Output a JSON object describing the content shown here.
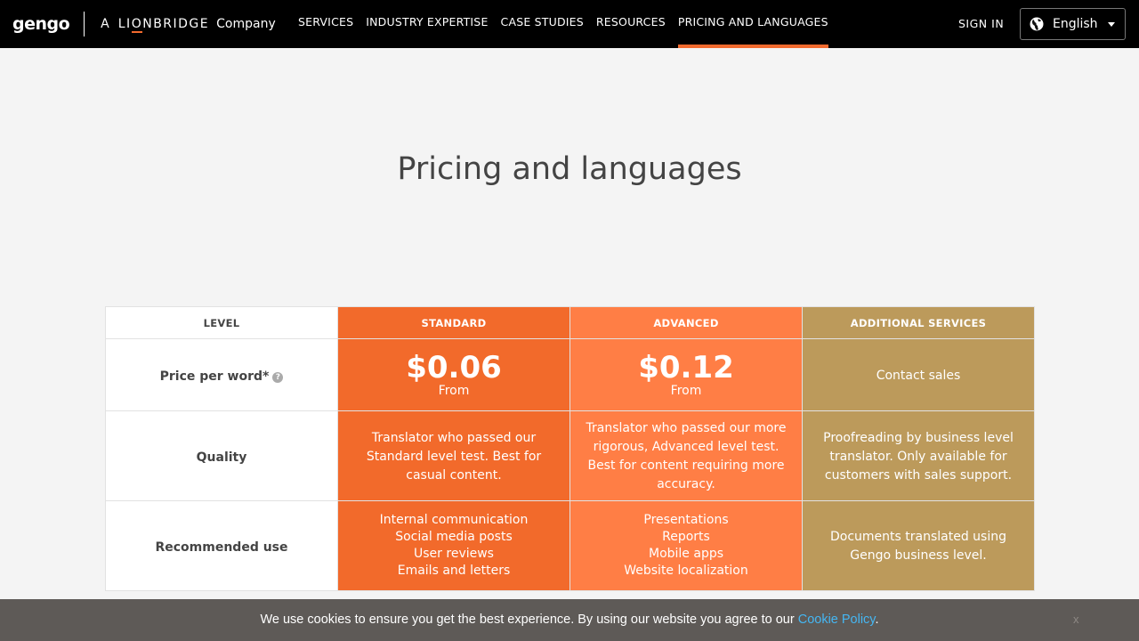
{
  "header": {
    "logo_text": "gengo",
    "brand_a": "A",
    "brand_lion_pre": "LI",
    "brand_lion_o": "O",
    "brand_lion_post": "NBRIDGE",
    "brand_company": "Company",
    "nav": [
      {
        "label": "SERVICES"
      },
      {
        "label": "INDUSTRY EXPERTISE"
      },
      {
        "label": "CASE STUDIES"
      },
      {
        "label": "RESOURCES"
      },
      {
        "label": "PRICING AND LANGUAGES",
        "active": true
      }
    ],
    "sign_in": "SIGN IN",
    "language": "English",
    "accent_color": "#f26a2e"
  },
  "page": {
    "title": "Pricing and languages"
  },
  "pricing_table": {
    "headers": {
      "level": "LEVEL",
      "standard": "STANDARD",
      "advanced": "ADVANCED",
      "additional": "ADDITIONAL SERVICES"
    },
    "price_row": {
      "label": "Price per word*",
      "help_glyph": "?",
      "standard_price": "$0.06",
      "standard_from": "From",
      "advanced_price": "$0.12",
      "advanced_from": "From",
      "additional": "Contact sales"
    },
    "quality_row": {
      "label": "Quality",
      "standard": "Translator who passed our Standard level test. Best for casual content.",
      "advanced": "Translator who passed our more rigorous, Advanced level test. Best for content requiring more accuracy.",
      "additional": "Proofreading by business level translator. Only available for customers with sales support."
    },
    "use_row": {
      "label": "Recommended use",
      "standard": [
        "Internal communication",
        "Social media posts",
        "User reviews",
        "Emails and letters"
      ],
      "advanced": [
        "Presentations",
        "Reports",
        "Mobile apps",
        "Website localization"
      ],
      "additional": "Documents translated using Gengo business level."
    },
    "colors": {
      "standard": "#f26a2b",
      "advanced": "#ff7e45",
      "additional": "#bc9a5b"
    }
  },
  "cookie_banner": {
    "text_before": "We use cookies to ensure you get the best experience. By using our website you agree to our ",
    "link_text": "Cookie Policy",
    "text_after": ".",
    "close_glyph": "x",
    "link_color": "#45b6f2"
  }
}
